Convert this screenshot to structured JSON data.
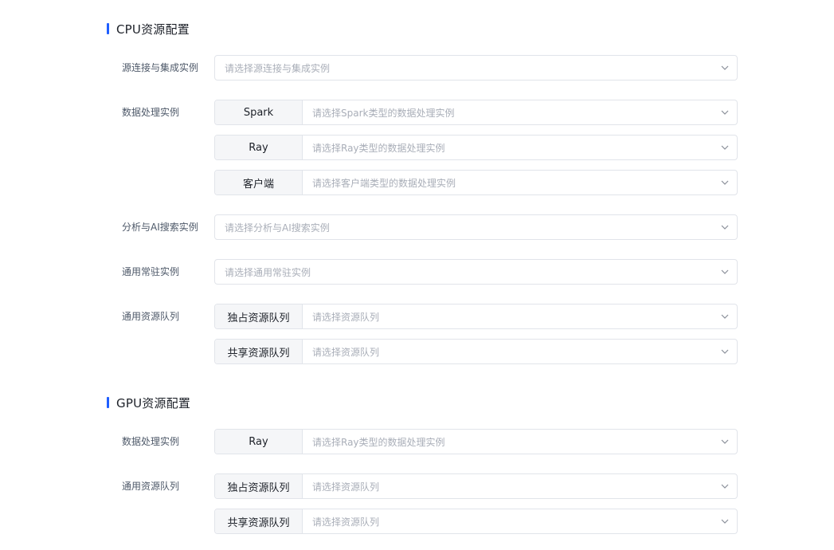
{
  "cpu_section": {
    "title": "CPU资源配置",
    "rows": {
      "source": {
        "label": "源连接与集成实例",
        "placeholder": "请选择源连接与集成实例"
      },
      "processing": {
        "label": "数据处理实例",
        "spark": {
          "addon": "Spark",
          "placeholder": "请选择Spark类型的数据处理实例"
        },
        "ray": {
          "addon": "Ray",
          "placeholder": "请选择Ray类型的数据处理实例"
        },
        "client": {
          "addon": "客户端",
          "placeholder": "请选择客户端类型的数据处理实例"
        }
      },
      "analysis": {
        "label": "分析与AI搜索实例",
        "placeholder": "请选择分析与AI搜索实例"
      },
      "resident": {
        "label": "通用常驻实例",
        "placeholder": "请选择通用常驻实例"
      },
      "queue": {
        "label": "通用资源队列",
        "exclusive": {
          "addon": "独占资源队列",
          "placeholder": "请选择资源队列"
        },
        "shared": {
          "addon": "共享资源队列",
          "placeholder": "请选择资源队列"
        }
      }
    }
  },
  "gpu_section": {
    "title": "GPU资源配置",
    "rows": {
      "processing": {
        "label": "数据处理实例",
        "ray": {
          "addon": "Ray",
          "placeholder": "请选择Ray类型的数据处理实例"
        }
      },
      "queue": {
        "label": "通用资源队列",
        "exclusive": {
          "addon": "独占资源队列",
          "placeholder": "请选择资源队列"
        },
        "shared": {
          "addon": "共享资源队列",
          "placeholder": "请选择资源队列"
        }
      }
    }
  },
  "icons": {
    "dropdown": "chevron-down-icon"
  },
  "colors": {
    "accent": "#1f5eff",
    "border": "#e1e4ea",
    "placeholder": "#a9aeb8",
    "addon_bg": "#f5f6f8"
  }
}
